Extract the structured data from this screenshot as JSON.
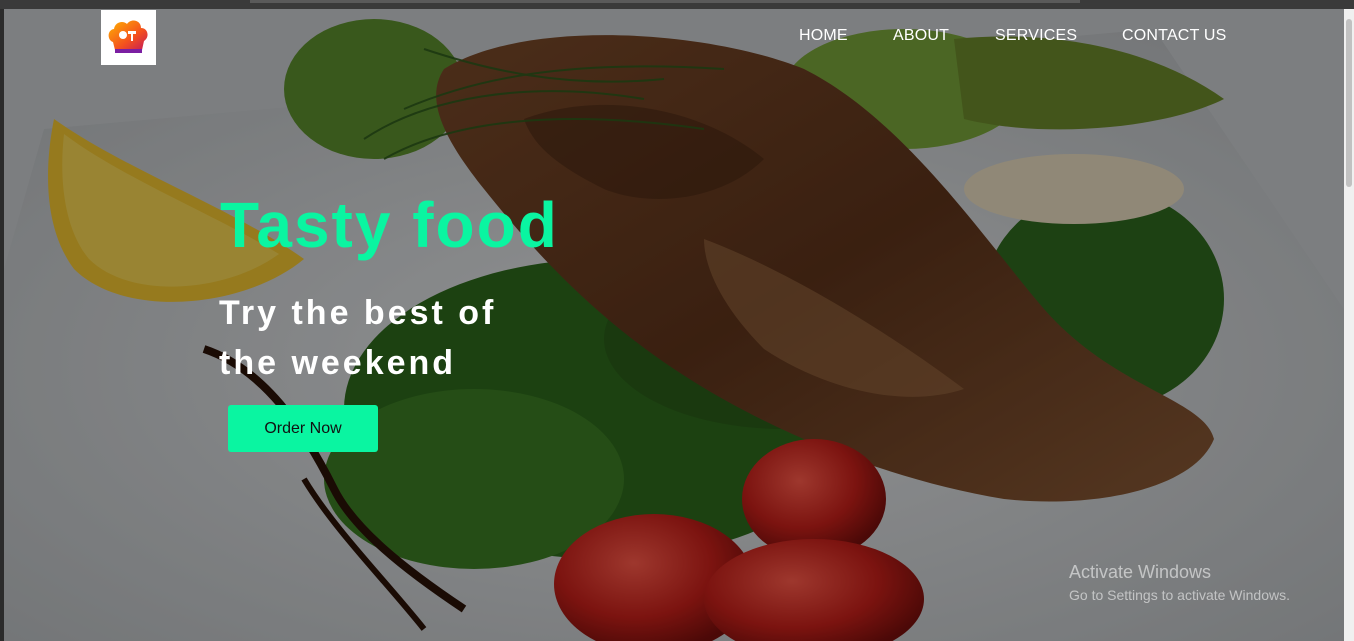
{
  "site": {
    "logo_alt": "chef-hat-logo"
  },
  "nav": {
    "items": [
      {
        "label": "HOME"
      },
      {
        "label": "ABOUT"
      },
      {
        "label": "SERVICES"
      },
      {
        "label": "CONTACT US"
      }
    ]
  },
  "hero": {
    "title": "Tasty food",
    "subtitle": "Try the best of the weekend",
    "button_label": "Order Now"
  },
  "os_watermark": {
    "title": "Activate Windows",
    "subtitle": "Go to Settings to activate Windows."
  },
  "colors": {
    "accent": "#0af5a1",
    "nav_text": "#ffffff"
  }
}
